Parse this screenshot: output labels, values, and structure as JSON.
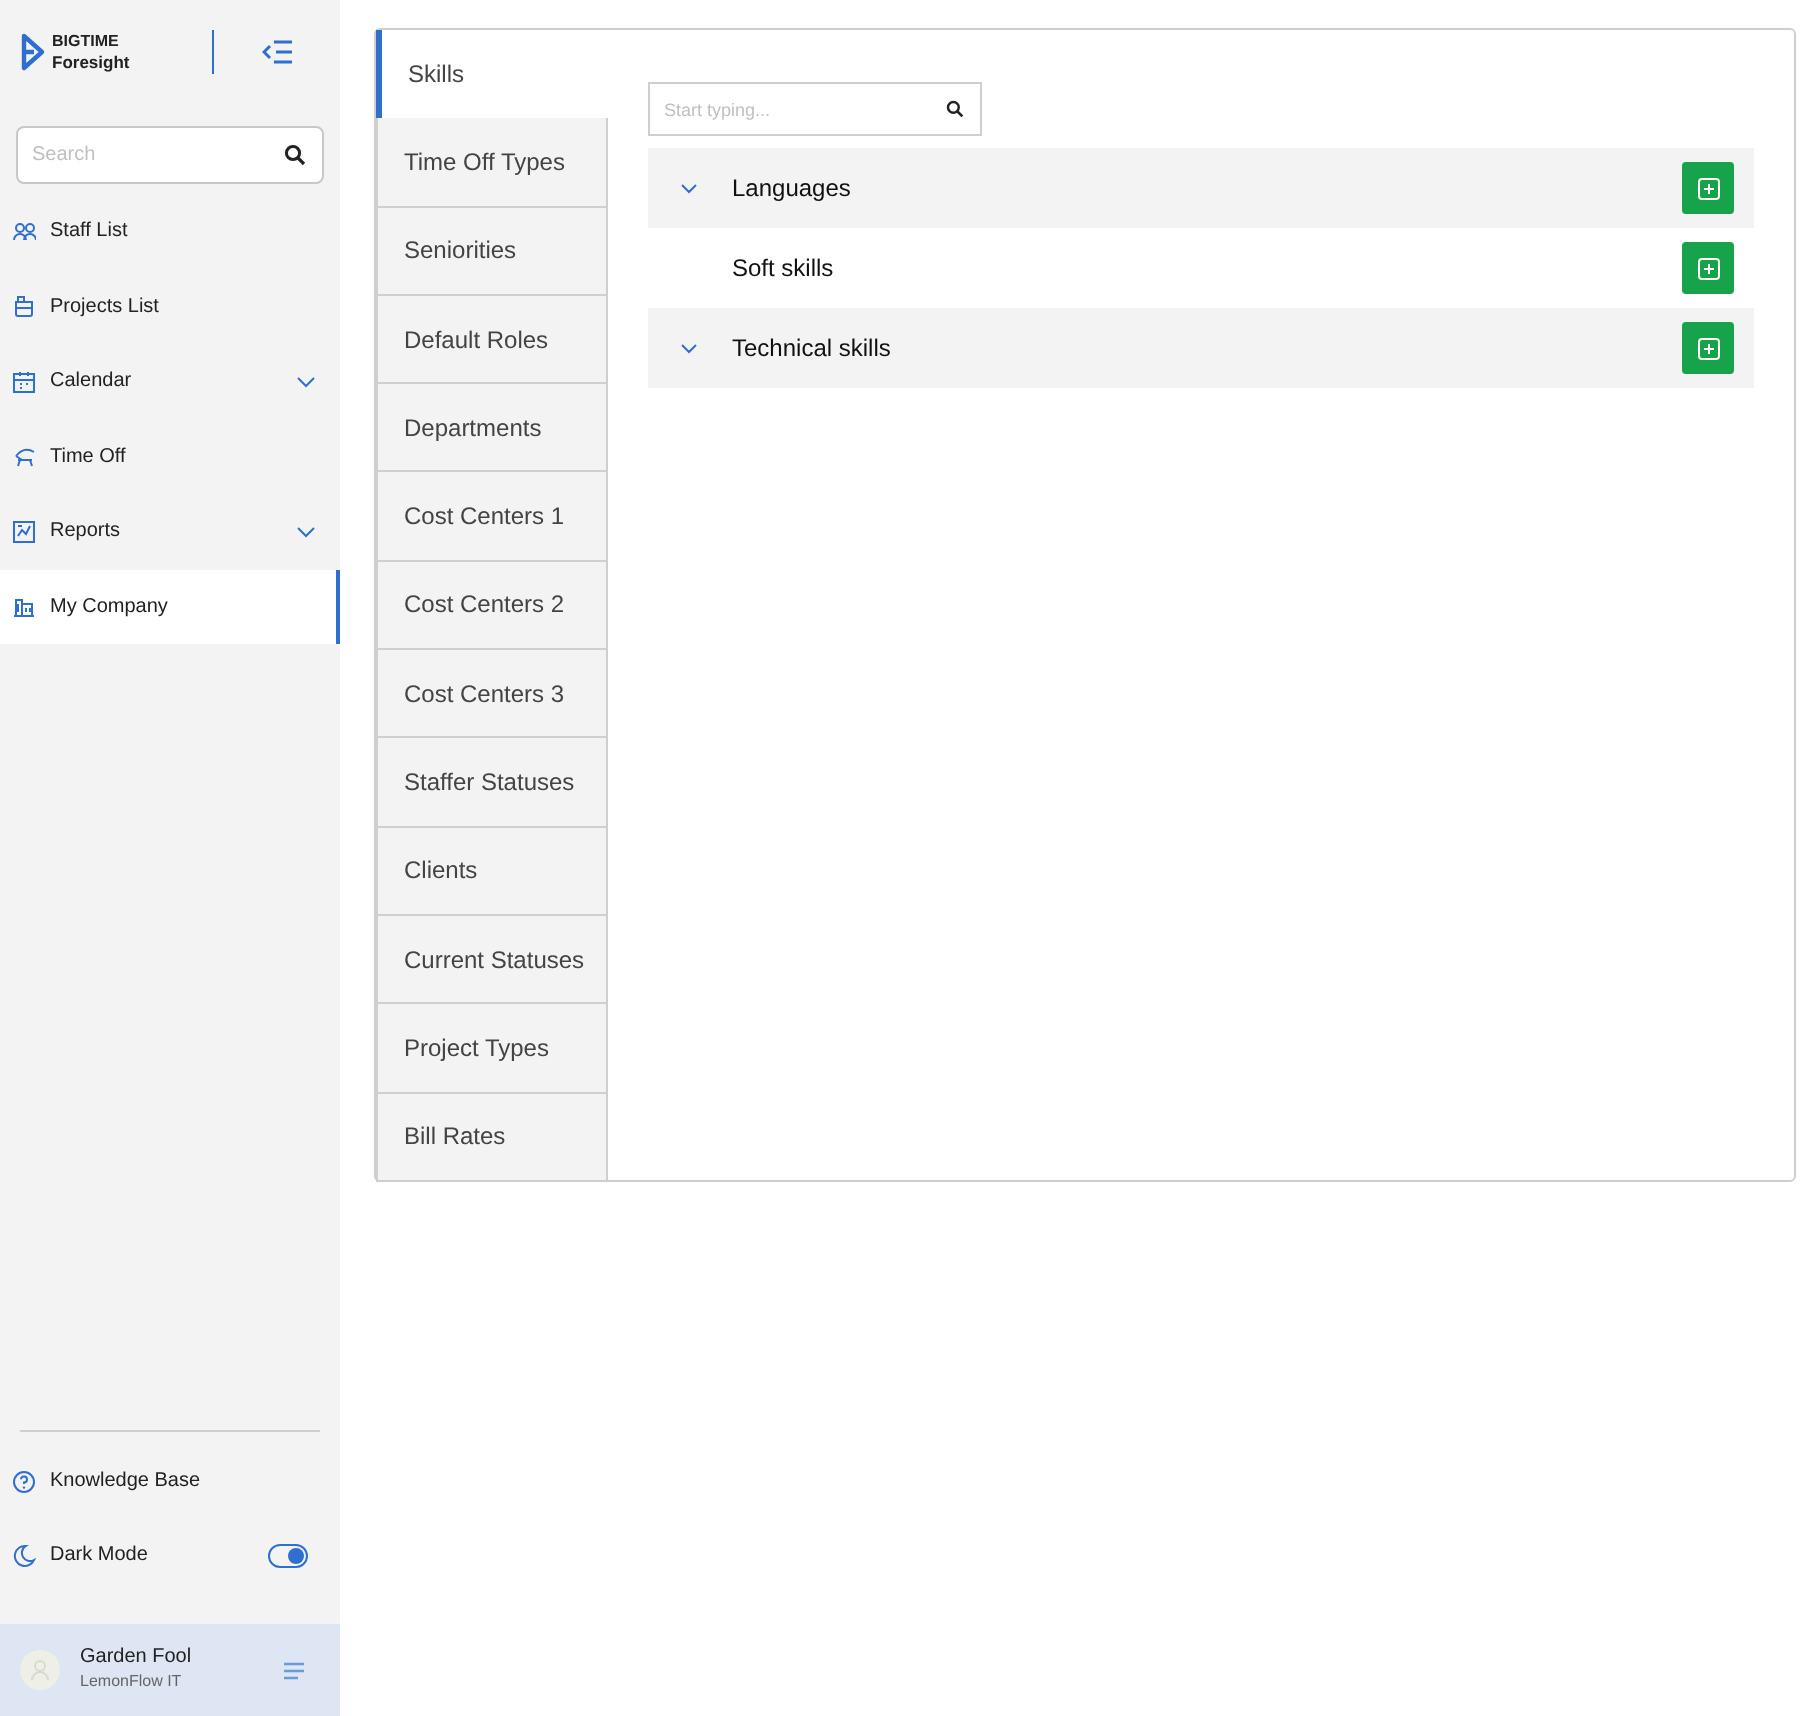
{
  "brand": {
    "line_1": "BIGTIME",
    "line_2": "Foresight"
  },
  "sidebar": {
    "search": {
      "placeholder": "Search"
    },
    "items": [
      {
        "label": "Staff List",
        "has_submenu": false,
        "selected": false
      },
      {
        "label": "Projects List",
        "has_submenu": false,
        "selected": false
      },
      {
        "label": "Calendar",
        "has_submenu": true,
        "selected": false
      },
      {
        "label": "Time Off",
        "has_submenu": false,
        "selected": false
      },
      {
        "label": "Reports",
        "has_submenu": true,
        "selected": false
      },
      {
        "label": "My Company",
        "has_submenu": false,
        "selected": true
      }
    ],
    "knowledge_base": "Knowledge Base",
    "dark_mode": {
      "label": "Dark Mode",
      "on": true
    },
    "user": {
      "name": "Garden Fool",
      "company": "LemonFlow IT"
    }
  },
  "tabs": [
    {
      "label": "Skills",
      "selected": true
    },
    {
      "label": "Time Off Types",
      "selected": false
    },
    {
      "label": "Seniorities",
      "selected": false
    },
    {
      "label": "Default Roles",
      "selected": false
    },
    {
      "label": "Departments",
      "selected": false
    },
    {
      "label": "Cost Centers 1",
      "selected": false
    },
    {
      "label": "Cost Centers 2",
      "selected": false
    },
    {
      "label": "Cost Centers 3",
      "selected": false
    },
    {
      "label": "Staffer Statuses",
      "selected": false
    },
    {
      "label": "Clients",
      "selected": false
    },
    {
      "label": "Current Statuses",
      "selected": false
    },
    {
      "label": "Project Types",
      "selected": false
    },
    {
      "label": "Bill Rates",
      "selected": false
    }
  ],
  "skills": {
    "search": {
      "placeholder": "Start typing..."
    },
    "groups": [
      {
        "label": "Languages",
        "expandable": true
      },
      {
        "label": "Soft skills",
        "expandable": false
      },
      {
        "label": "Technical skills",
        "expandable": true
      }
    ]
  }
}
